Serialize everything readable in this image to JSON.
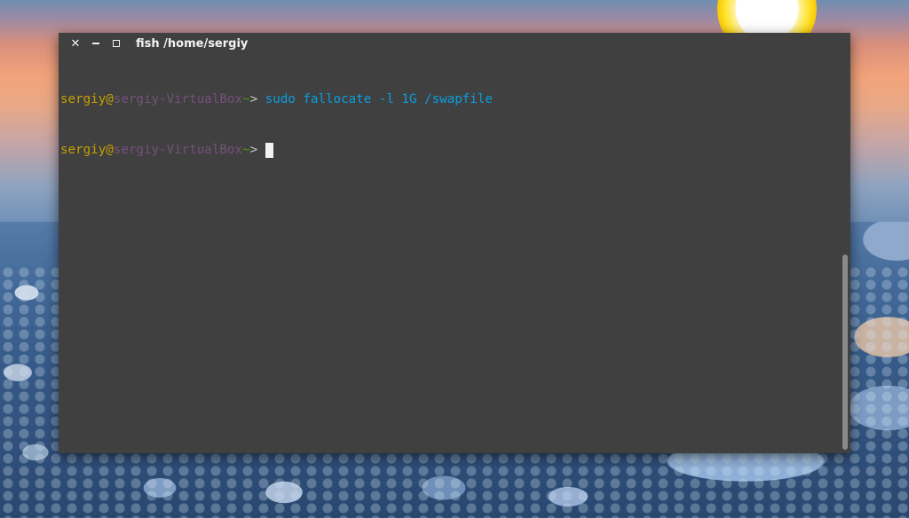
{
  "window": {
    "title": "fish  /home/sergiy",
    "controls": {
      "close": "✕",
      "minimize": "minimize",
      "maximize": "maximize"
    }
  },
  "terminal": {
    "lines": [
      {
        "user": "sergiy",
        "at": "@",
        "host": "sergiy-VirtualBox",
        "cwd": "~",
        "prompt": "> ",
        "command": "sudo fallocate -l 1G /swapfile"
      },
      {
        "user": "sergiy",
        "at": "@",
        "host": "sergiy-VirtualBox",
        "cwd": "~",
        "prompt": "> ",
        "command": ""
      }
    ]
  },
  "colors": {
    "terminal_bg": "#404040",
    "user": "#c4a000",
    "host": "#75507b",
    "cwd": "#4e9a06",
    "command": "#0a9fe0"
  }
}
